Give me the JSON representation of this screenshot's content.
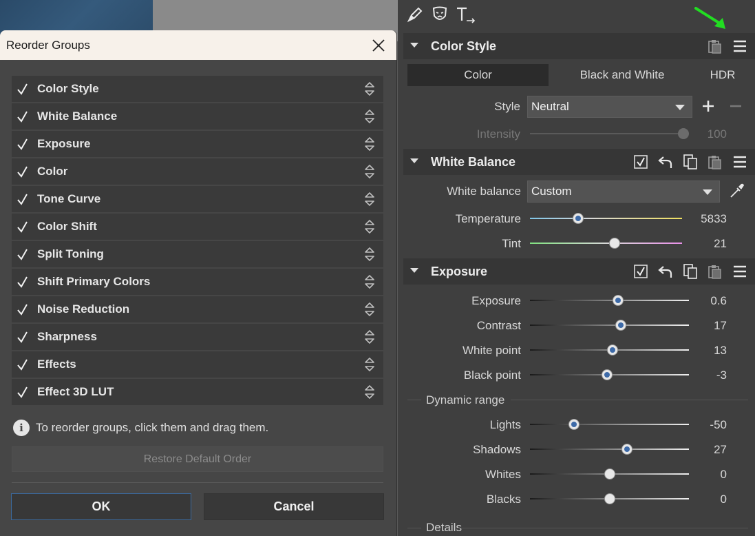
{
  "dialog": {
    "title": "Reorder Groups",
    "groups": [
      {
        "label": "Color Style",
        "checked": true
      },
      {
        "label": "White Balance",
        "checked": true
      },
      {
        "label": "Exposure",
        "checked": true
      },
      {
        "label": "Color",
        "checked": true
      },
      {
        "label": "Tone Curve",
        "checked": true
      },
      {
        "label": "Color Shift",
        "checked": true
      },
      {
        "label": "Split Toning",
        "checked": true
      },
      {
        "label": "Shift Primary Colors",
        "checked": true
      },
      {
        "label": "Noise Reduction",
        "checked": true
      },
      {
        "label": "Sharpness",
        "checked": true
      },
      {
        "label": "Effects",
        "checked": true
      },
      {
        "label": "Effect 3D LUT",
        "checked": true
      }
    ],
    "info_text": "To reorder groups, click them and drag them.",
    "restore_label": "Restore Default Order",
    "ok_label": "OK",
    "cancel_label": "Cancel"
  },
  "panel": {
    "color_style": {
      "title": "Color Style",
      "tabs": [
        "Color",
        "Black and White",
        "HDR"
      ],
      "active_tab": "Color",
      "style_label": "Style",
      "style_value": "Neutral",
      "intensity_label": "Intensity",
      "intensity_value": "100",
      "intensity_fraction": 1.0
    },
    "white_balance": {
      "title": "White Balance",
      "checked": true,
      "wb_label": "White balance",
      "wb_value": "Custom",
      "temperature_label": "Temperature",
      "temperature_value": "5833",
      "temperature_fraction": 0.3,
      "tint_label": "Tint",
      "tint_value": "21",
      "tint_fraction": 0.56
    },
    "exposure": {
      "title": "Exposure",
      "checked": true,
      "sliders": [
        {
          "label": "Exposure",
          "value": "0.6",
          "fraction": 0.56
        },
        {
          "label": "Contrast",
          "value": "17",
          "fraction": 0.575
        },
        {
          "label": "White point",
          "value": "13",
          "fraction": 0.52
        },
        {
          "label": "Black point",
          "value": "-3",
          "fraction": 0.485
        }
      ],
      "dynamic_range_label": "Dynamic range",
      "dynamic_sliders": [
        {
          "label": "Lights",
          "value": "-50",
          "fraction": 0.26
        },
        {
          "label": "Shadows",
          "value": "27",
          "fraction": 0.62
        },
        {
          "label": "Whites",
          "value": "0",
          "fraction": 0.5
        },
        {
          "label": "Blacks",
          "value": "0",
          "fraction": 0.5
        }
      ],
      "details_label": "Details"
    }
  },
  "colors": {
    "accent_blue": "#3d6aa8",
    "arrow_green": "#22dd22",
    "dialog_bg": "#464646",
    "titlebar_bg": "#f7f1ea"
  }
}
